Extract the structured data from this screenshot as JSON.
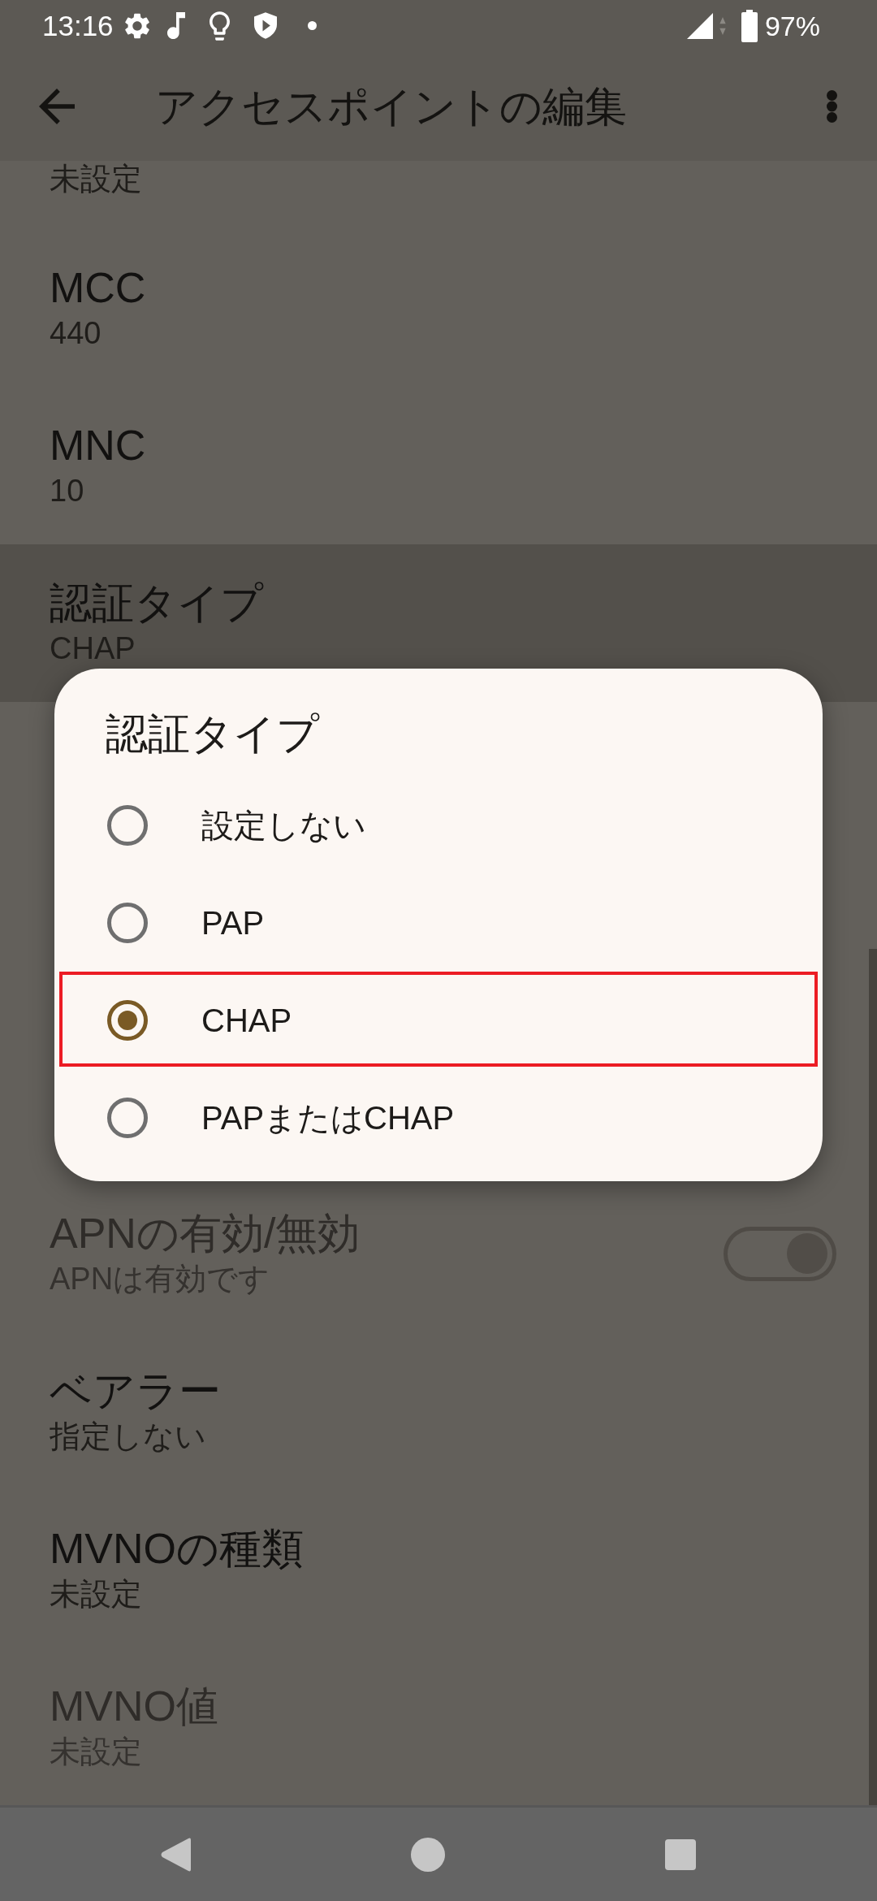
{
  "status_bar": {
    "time": "13:16",
    "battery": "97%"
  },
  "app_bar": {
    "title": "アクセスポイントの編集"
  },
  "settings_list": {
    "top_rows": [
      {
        "kind": "text",
        "value": "未設定",
        "selected": false,
        "disabled": false
      },
      {
        "kind": "text",
        "title": "MCC",
        "value": "440",
        "selected": false,
        "disabled": false
      },
      {
        "kind": "text",
        "title": "MNC",
        "value": "10",
        "selected": false,
        "disabled": false
      },
      {
        "kind": "text",
        "title": "認証タイプ",
        "value": "CHAP",
        "selected": true,
        "disabled": false
      }
    ],
    "bottom_rows": [
      {
        "kind": "switch",
        "title": "APNの有効/無効",
        "value": "APNは有効です",
        "selected": false,
        "disabled": true,
        "on": true
      },
      {
        "kind": "text",
        "title": "ベアラー",
        "value": "指定しない",
        "selected": false,
        "disabled": false
      },
      {
        "kind": "text",
        "title": "MVNOの種類",
        "value": "未設定",
        "selected": false,
        "disabled": false
      },
      {
        "kind": "text",
        "title": "MVNO値",
        "value": "未設定",
        "selected": false,
        "disabled": true
      }
    ]
  },
  "dialog": {
    "title": "認証タイプ",
    "options": [
      {
        "label": "設定しない",
        "selected": false,
        "annotated": false
      },
      {
        "label": "PAP",
        "selected": false,
        "annotated": false
      },
      {
        "label": "CHAP",
        "selected": true,
        "annotated": true
      },
      {
        "label": "PAPまたはCHAP",
        "selected": false,
        "annotated": false
      }
    ]
  }
}
